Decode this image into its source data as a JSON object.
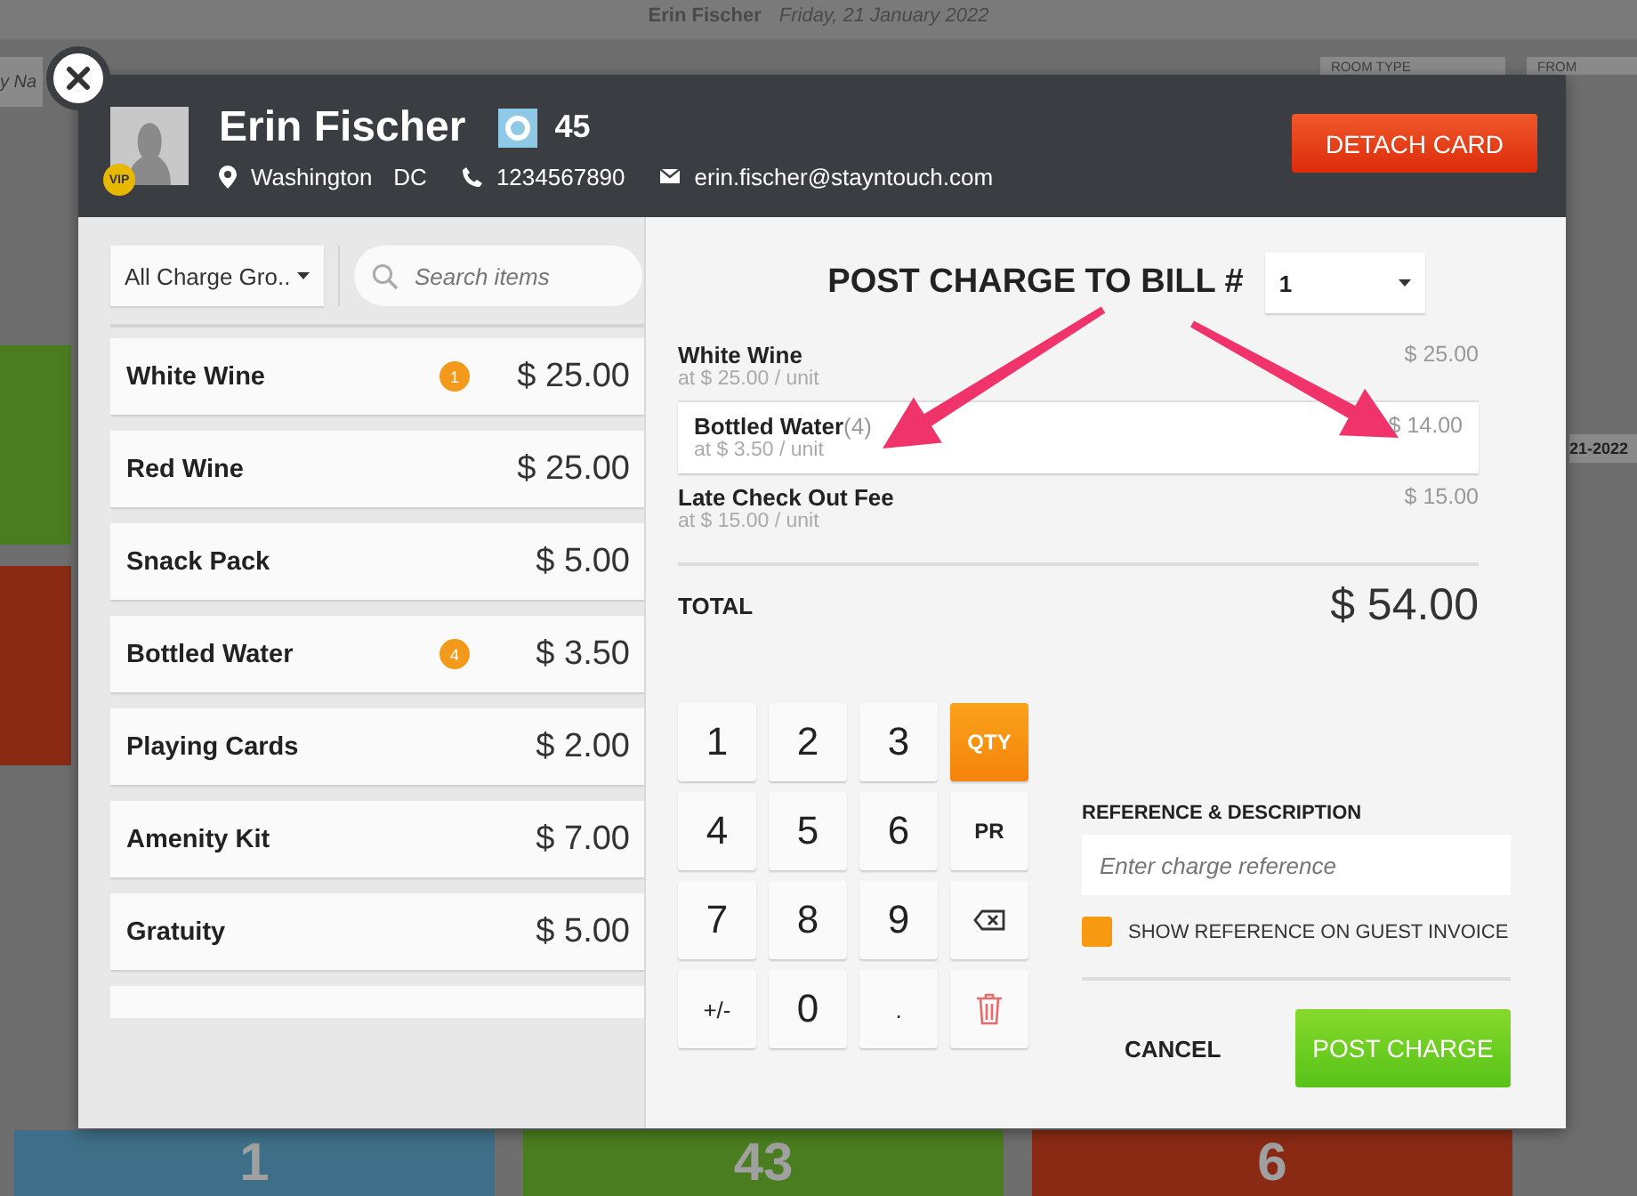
{
  "page": {
    "guest_name": "Erin Fischer",
    "date": "Friday, 21 January 2022",
    "search_partial": "y Na",
    "filters": [
      {
        "label": "ROOM TYPE"
      },
      {
        "label": "FROM"
      }
    ],
    "date_value": "21-2022",
    "stats": [
      {
        "value": "1",
        "color": "#3f6f88"
      },
      {
        "value": "43",
        "color": "#4a7d1f"
      },
      {
        "value": "6",
        "color": "#8a2a14"
      }
    ]
  },
  "modal": {
    "guest": {
      "name": "Erin Fischer",
      "vip": "VIP",
      "room": "45",
      "city": "Washington",
      "state": "DC",
      "phone": "1234567890",
      "email": "erin.fischer@stayntouch.com"
    },
    "detach_button": "DETACH CARD",
    "group_select": "All Charge Gro..",
    "search_placeholder": "Search items",
    "items": [
      {
        "name": "White Wine",
        "count": "1",
        "price": "$ 25.00"
      },
      {
        "name": "Red Wine",
        "price": "$ 25.00"
      },
      {
        "name": "Snack Pack",
        "price": "$ 5.00"
      },
      {
        "name": "Bottled Water",
        "count": "4",
        "price": "$ 3.50"
      },
      {
        "name": "Playing Cards",
        "price": "$ 2.00"
      },
      {
        "name": "Amenity Kit",
        "price": "$ 7.00"
      },
      {
        "name": "Gratuity",
        "price": "$ 5.00"
      }
    ],
    "title": "POST CHARGE TO BILL #",
    "bill": "1",
    "lines": [
      {
        "name": "White Wine",
        "unit": "at $ 25.00 / unit",
        "amount": "$ 25.00",
        "selected": false
      },
      {
        "name": "Bottled Water",
        "qty": "(4)",
        "unit": "at $ 3.50 / unit",
        "amount": "$ 14.00",
        "selected": true
      },
      {
        "name": "Late Check Out Fee",
        "unit": "at $ 15.00 / unit",
        "amount": "$ 15.00",
        "selected": false
      }
    ],
    "total_label": "TOTAL",
    "total": "$ 54.00",
    "keys": [
      {
        "kind": "digit",
        "label": "1"
      },
      {
        "kind": "digit",
        "label": "2"
      },
      {
        "kind": "digit",
        "label": "3"
      },
      {
        "kind": "mode",
        "label": "QTY",
        "selected": true
      },
      {
        "kind": "digit",
        "label": "4"
      },
      {
        "kind": "digit",
        "label": "5"
      },
      {
        "kind": "digit",
        "label": "6"
      },
      {
        "kind": "mode",
        "label": "PR",
        "selected": false
      },
      {
        "kind": "digit",
        "label": "7"
      },
      {
        "kind": "digit",
        "label": "8"
      },
      {
        "kind": "digit",
        "label": "9"
      },
      {
        "kind": "backspace"
      },
      {
        "kind": "small",
        "label": "+/-"
      },
      {
        "kind": "digit",
        "label": "0"
      },
      {
        "kind": "small",
        "label": "."
      },
      {
        "kind": "delete"
      }
    ],
    "reference_label": "REFERENCE & DESCRIPTION",
    "reference_placeholder": "Enter charge reference",
    "show_reference": {
      "label": "SHOW REFERENCE ON GUEST INVOICE",
      "checked": false
    },
    "cancel": "CANCEL",
    "post": "POST CHARGE"
  }
}
